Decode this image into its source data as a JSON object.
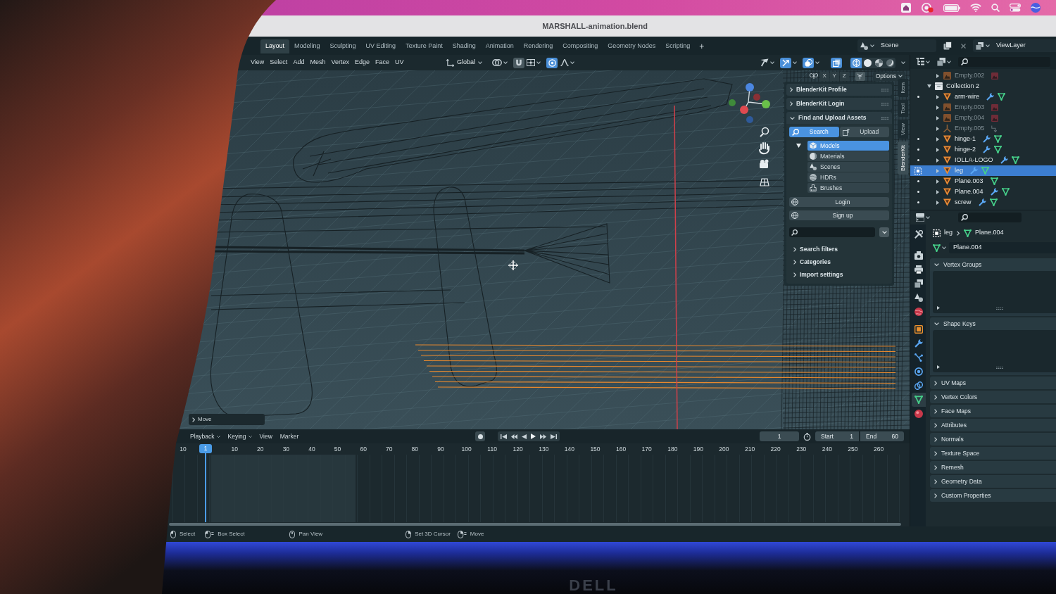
{
  "window": {
    "title": "MARSHALL-animation.blend"
  },
  "workspace_tabs": [
    {
      "label": "Layout",
      "selected": true
    },
    {
      "label": "Modeling",
      "selected": false
    },
    {
      "label": "Sculpting",
      "selected": false
    },
    {
      "label": "UV Editing",
      "selected": false
    },
    {
      "label": "Texture Paint",
      "selected": false
    },
    {
      "label": "Shading",
      "selected": false
    },
    {
      "label": "Animation",
      "selected": false
    },
    {
      "label": "Rendering",
      "selected": false
    },
    {
      "label": "Compositing",
      "selected": false
    },
    {
      "label": "Geometry Nodes",
      "selected": false
    },
    {
      "label": "Scripting",
      "selected": false
    }
  ],
  "add_workspace": "+",
  "scene": "Scene",
  "view_layer": "ViewLayer",
  "viewport_header": {
    "menus": [
      "View",
      "Select",
      "Add",
      "Mesh",
      "Vertex",
      "Edge",
      "Face",
      "UV"
    ],
    "orientation": "Global",
    "snap": false,
    "proportional_editing": true,
    "toggles": [
      {
        "kind": "gizmos",
        "on": true
      },
      {
        "kind": "overlays",
        "on": true
      },
      {
        "kind": "xray",
        "on": true
      }
    ],
    "shading": [
      {
        "kind": "wireframe",
        "selected": true
      },
      {
        "kind": "solid",
        "selected": false
      },
      {
        "kind": "material",
        "selected": false
      },
      {
        "kind": "rendered",
        "selected": false
      }
    ],
    "mirror_axes": [
      {
        "label": "X",
        "on": false
      },
      {
        "label": "Y",
        "on": false
      },
      {
        "label": "Z",
        "on": false
      }
    ],
    "options": "Options"
  },
  "sidebar": {
    "tabs": [
      {
        "label": "Item",
        "selected": false
      },
      {
        "label": "Tool",
        "selected": false
      },
      {
        "label": "View",
        "selected": false
      },
      {
        "label": "BlenderKit",
        "selected": true
      }
    ],
    "panels": [
      {
        "title": "BlenderKit Profile",
        "expanded": false
      },
      {
        "title": "BlenderKit Login",
        "expanded": false
      },
      {
        "title": "Find and Upload Assets",
        "expanded": true,
        "modes": [
          {
            "label": "Search",
            "kind": "search",
            "selected": true
          },
          {
            "label": "Upload",
            "kind": "upload",
            "selected": false
          }
        ],
        "asset_types": [
          {
            "label": "Models",
            "kind": "models",
            "selected": true
          },
          {
            "label": "Materials",
            "kind": "materials",
            "selected": false
          },
          {
            "label": "Scenes",
            "kind": "scenes",
            "selected": false
          },
          {
            "label": "HDRs",
            "kind": "hdrs",
            "selected": false
          },
          {
            "label": "Brushes",
            "kind": "brushes",
            "selected": false
          }
        ],
        "buttons": [
          "Login",
          "Sign up"
        ],
        "subpanels": [
          {
            "title": "Search filters",
            "expanded": false
          },
          {
            "title": "Categories",
            "expanded": false
          },
          {
            "title": "Import settings",
            "expanded": false
          }
        ]
      }
    ]
  },
  "operator_panel": {
    "title": "Move",
    "expanded": false
  },
  "timeline": {
    "menus": [
      {
        "label": "Playback",
        "kind": "dropdown"
      },
      {
        "label": "Keying",
        "kind": "dropdown"
      },
      {
        "label": "View",
        "kind": "menu"
      },
      {
        "label": "Marker",
        "kind": "menu"
      }
    ],
    "auto_keying": false,
    "current_frame": "1",
    "start": {
      "label": "Start",
      "value": "1"
    },
    "end": {
      "label": "End",
      "value": "60"
    },
    "ruler_before": [
      "10"
    ],
    "playhead": "1",
    "ruler_after": [
      "10",
      "20",
      "30",
      "40",
      "50",
      "60",
      "70",
      "80",
      "90",
      "100",
      "110",
      "120",
      "130",
      "140",
      "150",
      "160",
      "170",
      "180",
      "190",
      "200",
      "210",
      "220",
      "230",
      "240",
      "250",
      "260"
    ]
  },
  "status_bar": [
    {
      "label": "Select",
      "kind": "left_click"
    },
    {
      "label": "Box Select",
      "kind": "left_drag"
    },
    {
      "label": "Pan View",
      "kind": "middle_click"
    },
    {
      "label": "Set 3D Cursor",
      "kind": "right_click"
    },
    {
      "label": "Move",
      "kind": "right_drag"
    }
  ],
  "outliner": {
    "items": [
      {
        "children": [
          {
            "name": "Empty.002",
            "kind": "empty_image",
            "dimmed": true,
            "selected": false,
            "expanded": false
          }
        ]
      },
      {
        "name": "Collection 2",
        "kind": "collection",
        "dimmed": false,
        "selected": false,
        "expanded": true,
        "children": [
          {
            "name": "arm-wire",
            "kind": "mesh",
            "modifiers": true,
            "dimmed": false,
            "selected": false,
            "expanded": false
          },
          {
            "name": "Empty.003",
            "kind": "empty_image",
            "dimmed": true,
            "selected": false,
            "expanded": false
          },
          {
            "name": "Empty.004",
            "kind": "empty_image",
            "dimmed": true,
            "selected": false,
            "expanded": false
          },
          {
            "name": "Empty.005",
            "kind": "empty_axes",
            "dimmed": true,
            "selected": false,
            "expanded": false
          },
          {
            "name": "hinge-1",
            "kind": "mesh",
            "modifiers": true,
            "dimmed": false,
            "selected": false,
            "expanded": false
          },
          {
            "name": "hinge-2",
            "kind": "mesh",
            "modifiers": true,
            "dimmed": false,
            "selected": false,
            "expanded": false
          },
          {
            "name": "IOLLA-LOGO",
            "kind": "mesh",
            "modifiers": true,
            "dimmed": false,
            "selected": false,
            "expanded": false
          },
          {
            "name": "leg",
            "kind": "mesh",
            "modifiers": true,
            "dimmed": false,
            "selected": true,
            "expanded": false
          },
          {
            "name": "Plane.003",
            "kind": "mesh",
            "modifiers": false,
            "dimmed": false,
            "selected": false,
            "expanded": false
          },
          {
            "name": "Plane.004",
            "kind": "mesh",
            "modifiers": true,
            "dimmed": false,
            "selected": false,
            "expanded": false
          },
          {
            "name": "screw",
            "kind": "mesh",
            "modifiers": true,
            "dimmed": false,
            "selected": false,
            "expanded": false
          }
        ]
      }
    ]
  },
  "properties": {
    "tabs": [
      {
        "kind": "tool",
        "selected": false
      },
      {
        "kind": "render",
        "selected": false
      },
      {
        "kind": "output",
        "selected": false
      },
      {
        "kind": "view_layer",
        "selected": false
      },
      {
        "kind": "scene",
        "selected": false
      },
      {
        "kind": "world",
        "selected": false
      },
      {
        "kind": "object",
        "selected": false
      },
      {
        "kind": "modifiers",
        "selected": false
      },
      {
        "kind": "particles",
        "selected": false
      },
      {
        "kind": "physics",
        "selected": false
      },
      {
        "kind": "constraints",
        "selected": false
      },
      {
        "kind": "data",
        "selected": true
      },
      {
        "kind": "material",
        "selected": false
      }
    ],
    "breadcrumb": [
      "leg",
      "Plane.004"
    ],
    "datablock": "Plane.004",
    "panels": [
      {
        "title": "Vertex Groups",
        "expanded": true
      },
      {
        "title": "Shape Keys",
        "expanded": true
      },
      {
        "title": "UV Maps",
        "expanded": false
      },
      {
        "title": "Vertex Colors",
        "expanded": false
      },
      {
        "title": "Face Maps",
        "expanded": false
      },
      {
        "title": "Attributes",
        "expanded": false
      },
      {
        "title": "Normals",
        "expanded": false
      },
      {
        "title": "Texture Space",
        "expanded": false
      },
      {
        "title": "Remesh",
        "expanded": false
      },
      {
        "title": "Geometry Data",
        "expanded": false
      },
      {
        "title": "Custom Properties",
        "expanded": false
      }
    ]
  },
  "monitor": {
    "logo": "DELL"
  }
}
